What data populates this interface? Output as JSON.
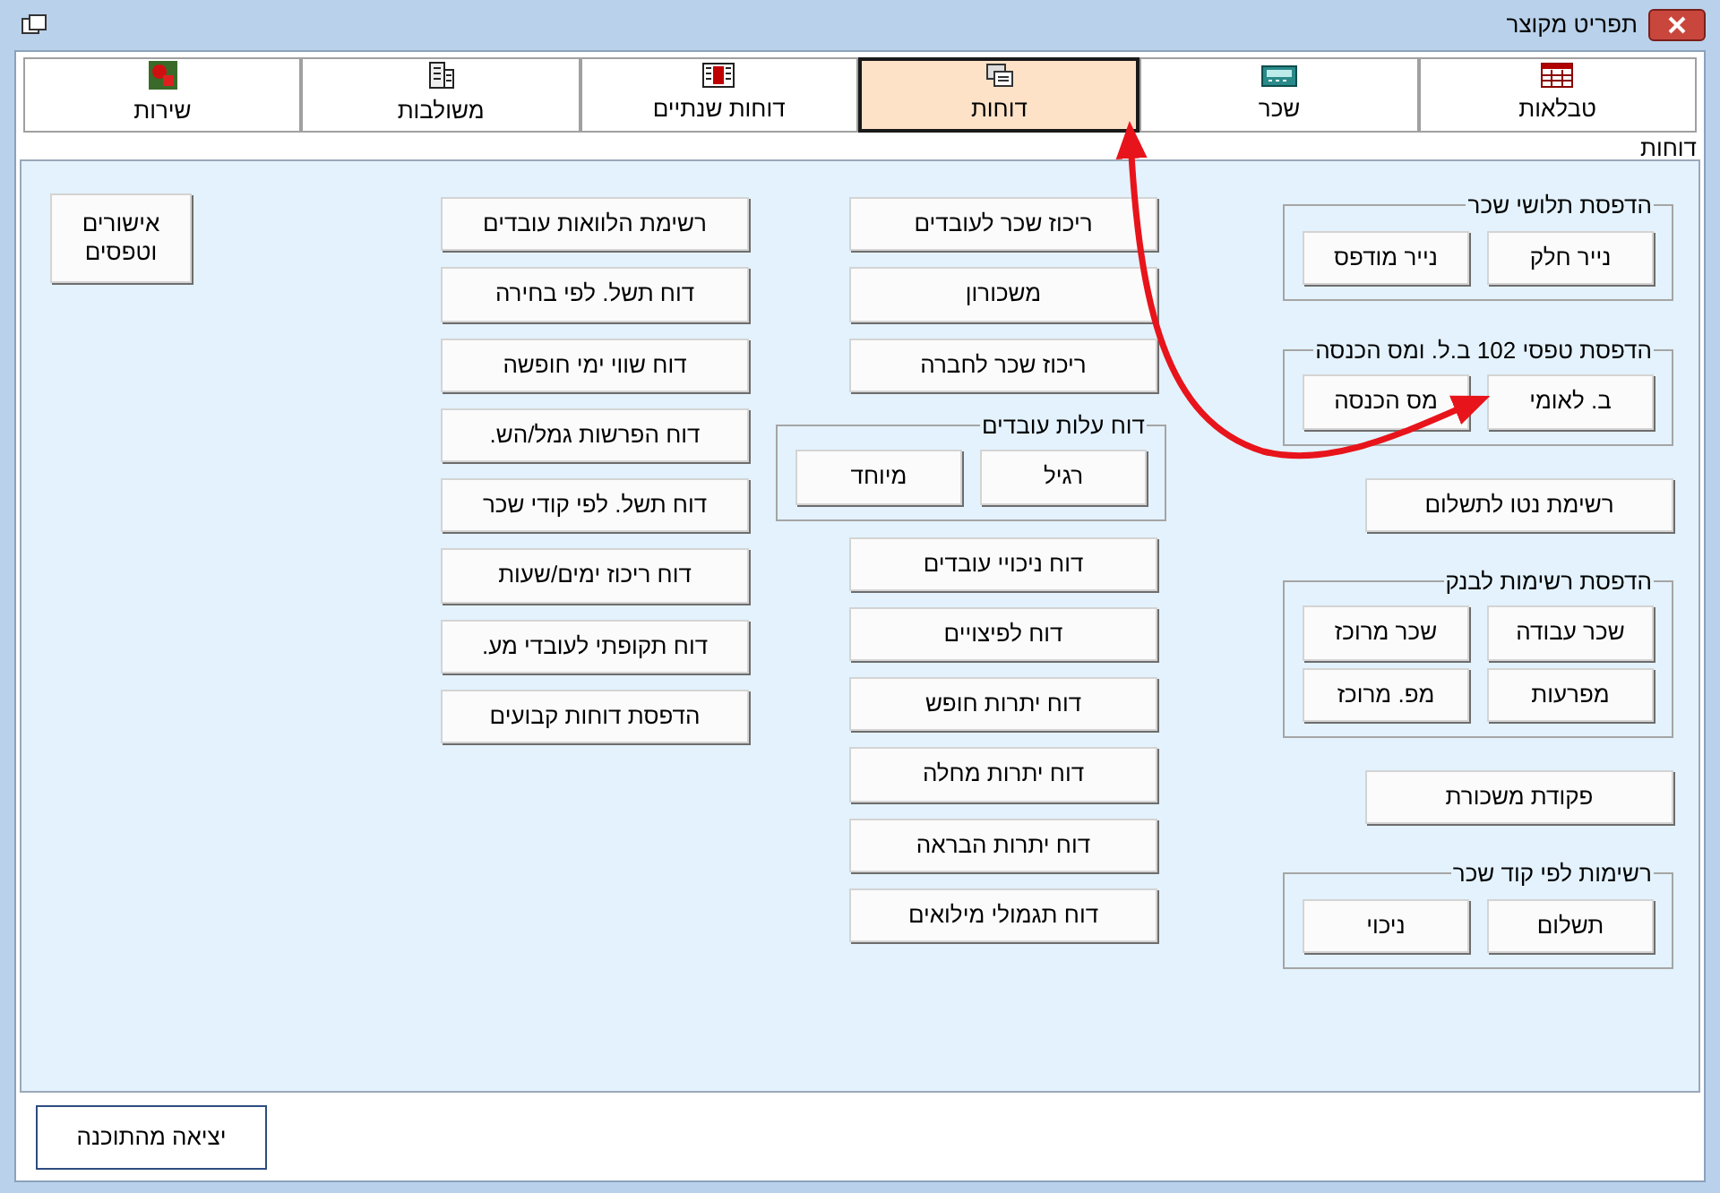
{
  "window": {
    "title": "תפריט מקוצר"
  },
  "tabs": [
    {
      "label": "טבלאות",
      "selected": false
    },
    {
      "label": "שכר",
      "selected": false
    },
    {
      "label": "דוחות",
      "selected": true
    },
    {
      "label": "דוחות שנתיים",
      "selected": false
    },
    {
      "label": "משולבות",
      "selected": false
    },
    {
      "label": "שירות",
      "selected": false
    }
  ],
  "panel": {
    "title": "דוחות",
    "columns": [
      {
        "items": [
          {
            "kind": "group",
            "title": "הדפסת תלושי שכר",
            "rows": [
              [
                "נייר חלק",
                "נייר מודפס"
              ]
            ]
          },
          {
            "kind": "group",
            "title": "הדפסת טפסי 102 ב.ל. ומס הכנסה",
            "rows": [
              [
                "ב. לאומי",
                "מס הכנסה"
              ]
            ]
          },
          {
            "kind": "button",
            "label": "רשימת נטו לתשלום"
          },
          {
            "kind": "group",
            "title": "הדפסת רשימות לבנק",
            "rows": [
              [
                "שכר עבודה",
                "שכר מרוכז"
              ],
              [
                "מפרעות",
                "מפ. מרוכז"
              ]
            ]
          },
          {
            "kind": "button",
            "label": "פקודת משכורת"
          },
          {
            "kind": "group",
            "title": "רשימות לפי קוד שכר",
            "rows": [
              [
                "תשלום",
                "ניכוי"
              ]
            ]
          }
        ]
      },
      {
        "items": [
          {
            "kind": "button",
            "label": "ריכוז שכר לעובדים"
          },
          {
            "kind": "button",
            "label": "משכורון"
          },
          {
            "kind": "button",
            "label": "ריכוז שכר לחברה"
          },
          {
            "kind": "group",
            "title": "דוח עלות עובדים",
            "rows": [
              [
                "רגיל",
                "מיוחד"
              ]
            ]
          },
          {
            "kind": "button",
            "label": "דוח ניכויי עובדים"
          },
          {
            "kind": "button",
            "label": "דוח לפיצויים"
          },
          {
            "kind": "button",
            "label": "דוח יתרות חופש"
          },
          {
            "kind": "button",
            "label": "דוח יתרות מחלה"
          },
          {
            "kind": "button",
            "label": "דוח יתרות הבראה"
          },
          {
            "kind": "button",
            "label": "דוח תגמולי מילואים"
          }
        ]
      },
      {
        "items": [
          {
            "kind": "button",
            "label": "רשימת הלוואות עובדים"
          },
          {
            "kind": "button",
            "label": "דוח תשל. לפי בחירה"
          },
          {
            "kind": "button",
            "label": "דוח שווי ימי חופשה"
          },
          {
            "kind": "button",
            "label": "דוח הפרשות גמל/הש."
          },
          {
            "kind": "button",
            "label": "דוח תשל. לפי קודי שכר"
          },
          {
            "kind": "button",
            "label": "דוח ריכוז ימים/שעות"
          },
          {
            "kind": "button",
            "label": "דוח תקופתי לעובדי מע."
          },
          {
            "kind": "button",
            "label": "הדפסת דוחות קבועים"
          }
        ]
      },
      {
        "items": [
          {
            "kind": "button",
            "label": "אישורים וטפסים"
          }
        ]
      }
    ]
  },
  "exit_button": "יציאה מהתוכנה"
}
